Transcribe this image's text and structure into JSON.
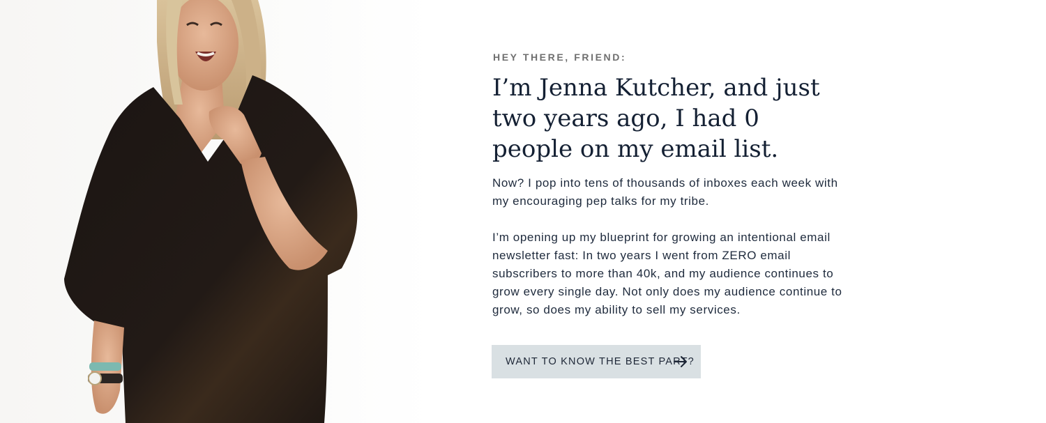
{
  "intro": {
    "eyebrow": "HEY THERE, FRIEND:",
    "headline": "I’m Jenna Kutcher, and just two years ago, I had 0 people on my email list.",
    "paragraph_1": "Now? I pop into tens of thousands of inboxes each week with my encouraging pep talks for my tribe.",
    "paragraph_2": "I’m opening up my blueprint for growing an intentional email newsletter fast: In two years I went from ZERO email subscribers to more than 40k, and my audience continues to grow every single day. Not only does my audience continue to grow, so does my ability to sell my services."
  },
  "cta": {
    "label": "WANT TO KNOW THE BEST PART?",
    "icon": "arrow-right-icon"
  },
  "photo": {
    "subject": "portrait-photo"
  },
  "colors": {
    "heading": "#142033",
    "body": "#1e2a3c",
    "eyebrow": "#6f6f6f",
    "button_bg": "#d9e0e3",
    "background": "#ffffff"
  }
}
